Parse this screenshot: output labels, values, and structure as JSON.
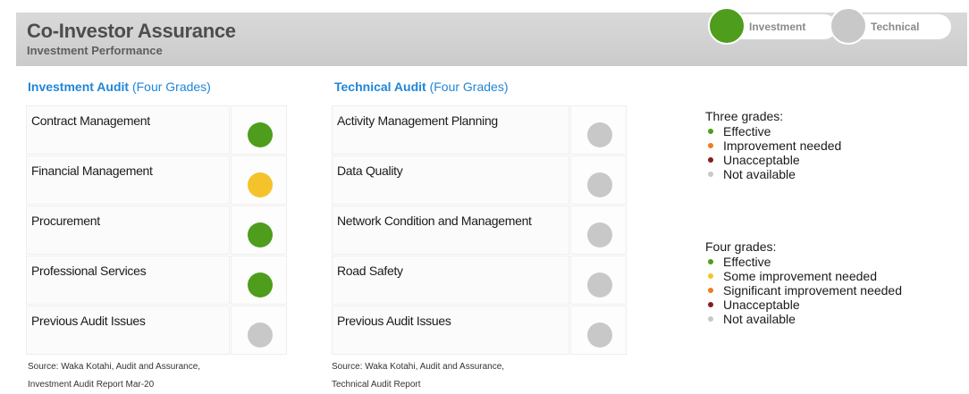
{
  "header": {
    "title": "Co-Investor Assurance",
    "subtitle": "Investment Performance",
    "toggles": [
      {
        "label": "Investment",
        "color": "#4e9d1c"
      },
      {
        "label": "Technical",
        "color": "#c8c8c8"
      }
    ]
  },
  "investment_audit": {
    "title": "Investment Audit",
    "grades": "(Four Grades)",
    "rows": [
      {
        "label": "Contract Management",
        "status": "Effective",
        "color": "#4e9d1c"
      },
      {
        "label": "Financial Management",
        "status": "Some improvement needed",
        "color": "#f4c22b"
      },
      {
        "label": "Procurement",
        "status": "Effective",
        "color": "#4e9d1c"
      },
      {
        "label": "Professional Services",
        "status": "Effective",
        "color": "#4e9d1c"
      },
      {
        "label": "Previous Audit Issues",
        "status": "Not available",
        "color": "#c8c8c8"
      }
    ],
    "source_line1": "Source: Waka Kotahi, Audit and Assurance,",
    "source_line2": "Investment Audit Report Mar-20"
  },
  "technical_audit": {
    "title": "Technical Audit",
    "grades": "(Four Grades)",
    "rows": [
      {
        "label": "Activity Management Planning",
        "status": "Not available",
        "color": "#c8c8c8"
      },
      {
        "label": "Data Quality",
        "status": "Not available",
        "color": "#c8c8c8"
      },
      {
        "label": "Network Condition and Management",
        "status": "Not available",
        "color": "#c8c8c8"
      },
      {
        "label": "Road Safety",
        "status": "Not available",
        "color": "#c8c8c8"
      },
      {
        "label": "Previous Audit Issues",
        "status": "Not available",
        "color": "#c8c8c8"
      }
    ],
    "source_line1": "Source: Waka Kotahi, Audit and Assurance,",
    "source_line2": "Technical Audit Report"
  },
  "legend_three": {
    "title": "Three grades:",
    "items": [
      {
        "label": "Effective",
        "color": "#4e9d1c"
      },
      {
        "label": "Improvement needed",
        "color": "#f07c1e"
      },
      {
        "label": "Unacceptable",
        "color": "#8a1c1c"
      },
      {
        "label": "Not available",
        "color": "#c8c8c8"
      }
    ]
  },
  "legend_four": {
    "title": "Four grades:",
    "items": [
      {
        "label": "Effective",
        "color": "#4e9d1c"
      },
      {
        "label": "Some improvement needed",
        "color": "#f4c22b"
      },
      {
        "label": "Significant improvement needed",
        "color": "#f07c1e"
      },
      {
        "label": "Unacceptable",
        "color": "#8a1c1c"
      },
      {
        "label": "Not available",
        "color": "#c8c8c8"
      }
    ]
  }
}
